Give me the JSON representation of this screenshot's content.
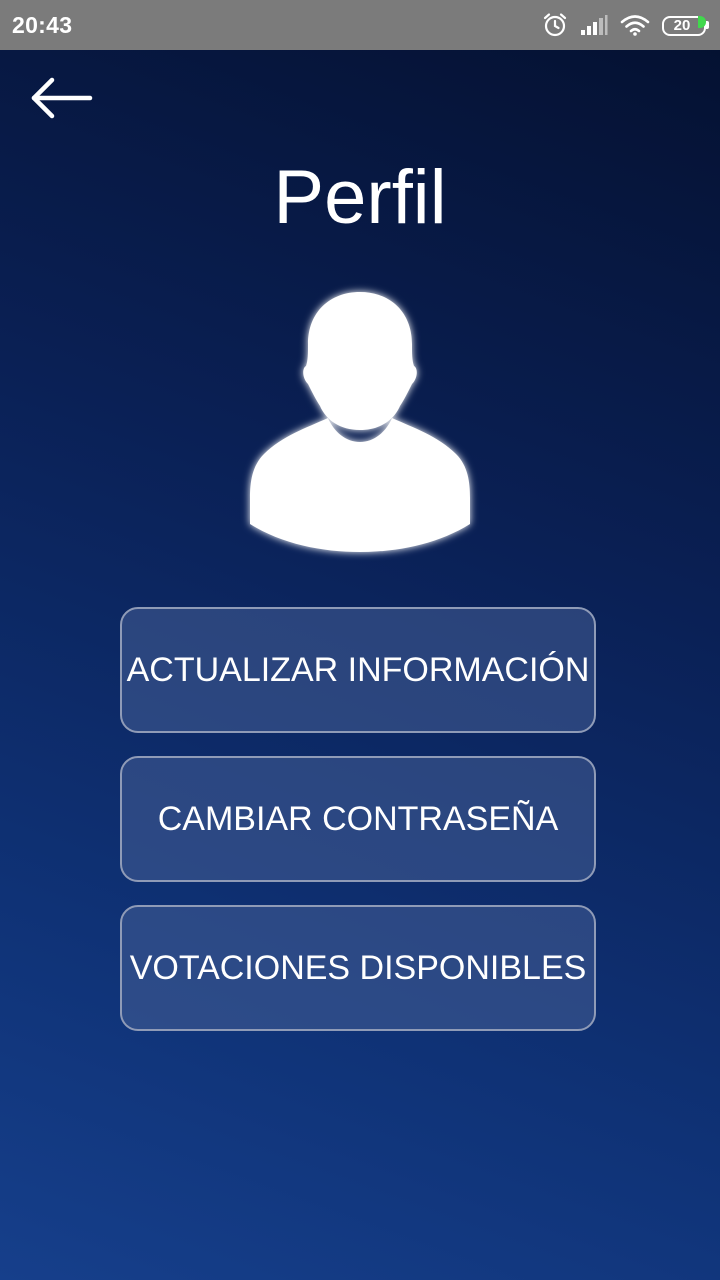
{
  "status_bar": {
    "time": "20:43",
    "battery_level": "20",
    "icons": [
      "alarm-icon",
      "signal-icon",
      "wifi-icon",
      "battery-icon"
    ],
    "battery_color": "#41d84d"
  },
  "header": {
    "back_icon": "back-arrow-icon",
    "title": "Perfil"
  },
  "avatar": {
    "icon": "user-silhouette-icon"
  },
  "actions": [
    {
      "label": "ACTUALIZAR INFORMACIÓN"
    },
    {
      "label": "CAMBIAR CONTRASEÑA"
    },
    {
      "label": "VOTACIONES DISPONIBLES"
    }
  ],
  "colors": {
    "background_top": "#04102f",
    "background_bottom": "#163f8b",
    "status_bar": "#7b7b7b",
    "button_border": "#8f9bb7",
    "text": "#ffffff"
  }
}
